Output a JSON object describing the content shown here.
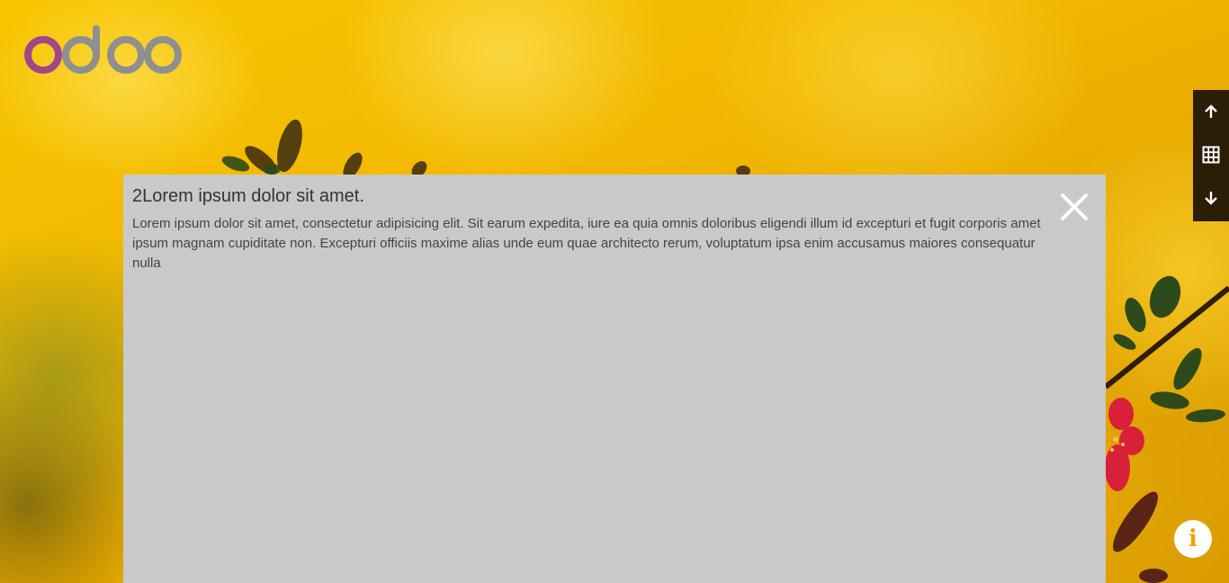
{
  "brand": {
    "logo_text": "odoo",
    "colors": {
      "o1": "#a24689",
      "rest": "#8f8f8f"
    }
  },
  "panel": {
    "title": "2Lorem ipsum dolor sit amet.",
    "body": "Lorem ipsum dolor sit amet, consectetur adipisicing elit. Sit earum expedita, iure ea quia omnis doloribus eligendi illum id excepturi et fugit corporis amet ipsum magnam cupiditate non. Excepturi officiis maxime alias unde eum quae architecto rerum, voluptatum ipsa enim accusamus maiores consequatur nulla",
    "close_icon": "close-icon"
  },
  "nav": {
    "up_icon": "arrow-up-icon",
    "grid_icon": "grid-icon",
    "down_icon": "arrow-down-icon"
  },
  "info": {
    "glyph": "i",
    "icon": "info-icon"
  },
  "colors": {
    "panel_bg": "#c9c9c9",
    "nav_bg": "#2b1d06",
    "info_accent": "#e8a600"
  }
}
